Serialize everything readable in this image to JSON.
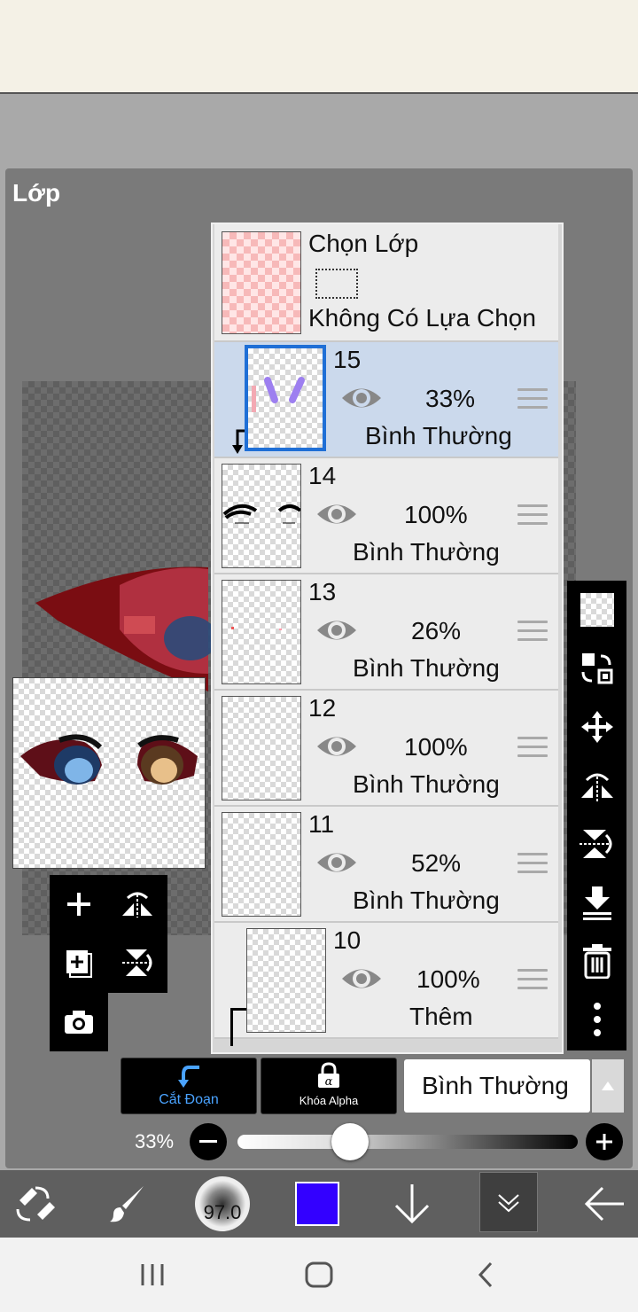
{
  "panel": {
    "title": "Lớp"
  },
  "select_layer": {
    "title": "Chọn Lớp",
    "status": "Không Có Lựa Chọn"
  },
  "layers": [
    {
      "number": "15",
      "opacity": "33%",
      "blend": "Bình Thường",
      "selected": true,
      "clipped": true
    },
    {
      "number": "14",
      "opacity": "100%",
      "blend": "Bình Thường",
      "selected": false
    },
    {
      "number": "13",
      "opacity": "26%",
      "blend": "Bình Thường",
      "selected": false
    },
    {
      "number": "12",
      "opacity": "100%",
      "blend": "Bình Thường",
      "selected": false
    },
    {
      "number": "11",
      "opacity": "52%",
      "blend": "Bình Thường",
      "selected": false
    },
    {
      "number": "10",
      "opacity": "100%",
      "blend": "Thêm",
      "selected": false,
      "clipped": true
    }
  ],
  "controls": {
    "clip_label": "Cắt Đoạn",
    "alpha_lock_label": "Khóa Alpha",
    "blend_mode": "Bình Thường",
    "opacity_label": "33%",
    "opacity_value": 0.33
  },
  "bottom_bar": {
    "brush_size": "97.0",
    "current_color": "#3300ff"
  },
  "colors": {
    "accent_blue": "#1f6fd6",
    "selection_row": "#cbd9ec",
    "clip_blue": "#4aa3ff"
  },
  "icons": {
    "side_tools": [
      "checker-icon",
      "copy-merge-icon",
      "move-icon",
      "flip-horizontal-icon",
      "flip-vertical-icon",
      "merge-down-icon",
      "trash-icon",
      "more-icon"
    ],
    "left_tools": [
      "add-layer-icon",
      "flip-horizontal-icon",
      "add-copy-icon",
      "flip-vertical-icon",
      "camera-icon"
    ],
    "bottom": [
      "swap-tool-icon",
      "brush-icon",
      "brush-size-icon",
      "color-swatch",
      "down-arrow-icon",
      "collapse-icon",
      "back-arrow-icon"
    ],
    "nav": [
      "recent-apps-icon",
      "home-icon",
      "back-icon"
    ]
  }
}
